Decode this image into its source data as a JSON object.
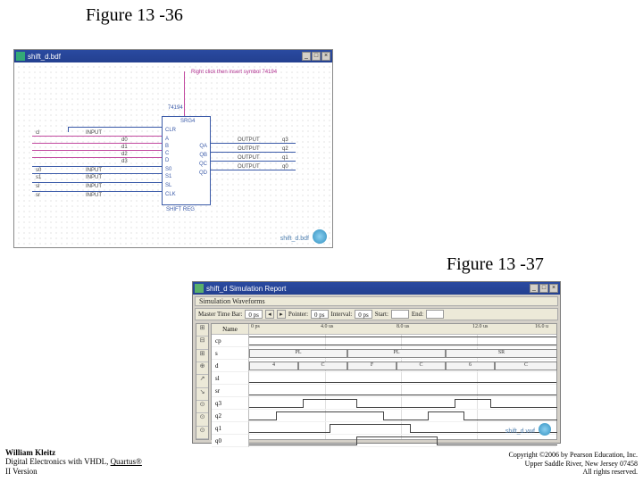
{
  "figure1": {
    "label": "Figure 13 -36",
    "window_title": "shift_d.bdf",
    "annotations": {
      "right_click": "Right click then insert symbol 74194",
      "chip_name": "74194",
      "block_name": "SRG4",
      "bottom_label": "SHIFT REG"
    },
    "left_pins": [
      "cl",
      "d0",
      "d1",
      "d2",
      "d3",
      "s0",
      "s1",
      "sl",
      "sr"
    ],
    "chip_left": [
      "CLR",
      "A",
      "B",
      "C",
      "D",
      "S0",
      "S1",
      "SL",
      "CLK"
    ],
    "chip_right": [
      "QA",
      "QB",
      "QC",
      "QD"
    ],
    "right_pins": [
      "OUTPUT",
      "OUTPUT",
      "OUTPUT",
      "OUTPUT"
    ],
    "right_labels": [
      "q3",
      "q2",
      "q1",
      "q0"
    ],
    "logo_label": "shift_d.bdf"
  },
  "figure2": {
    "label": "Figure 13 -37",
    "window_title": "shift_d Simulation Report",
    "subheader": "Simulation Waveforms",
    "toolbar": {
      "master_label": "Master Time Bar:",
      "master_val": "0 ps",
      "pointer_label": "Pointer:",
      "pointer_val": "0 ps",
      "interval_label": "Interval:",
      "interval_val": "0 ps",
      "start_label": "Start:",
      "end_label": "End:"
    },
    "name_header": "Name",
    "time_ticks": [
      "0 ps",
      "4.0 us",
      "8.0 us",
      "12.0 us",
      "16.0 u"
    ],
    "signals": [
      "cp",
      "s",
      "d",
      "sl",
      "sr",
      "q3",
      "q2",
      "q1",
      "q0"
    ],
    "bus_s_segments": [
      "PL",
      "PL",
      "SR"
    ],
    "bus_d_segments": [
      "4",
      "C",
      "F",
      "C",
      "6",
      "C"
    ],
    "logo_label": "shift_d.vwf"
  },
  "footer": {
    "author": "William Kleitz",
    "book_a": "Digital Electronics with VHDL, ",
    "book_b": "Quartus®",
    "book_c": " II Version",
    "copyright": "Copyright ©2006 by Pearson Education, Inc.",
    "addr": "Upper Saddle River, New Jersey 07458",
    "rights": "All rights reserved."
  }
}
